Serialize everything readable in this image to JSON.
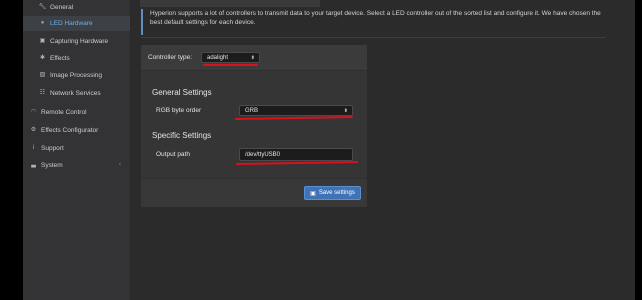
{
  "sidebar": {
    "items": [
      {
        "label": "General",
        "icon": "wrench-icon",
        "level": "sub",
        "active": false
      },
      {
        "label": "LED Hardware",
        "icon": "lightbulb-icon",
        "level": "sub",
        "active": true
      },
      {
        "label": "Capturing Hardware",
        "icon": "camera-icon",
        "level": "sub",
        "active": false
      },
      {
        "label": "Effects",
        "icon": "magic-icon",
        "level": "sub",
        "active": false
      },
      {
        "label": "Image Processing",
        "icon": "image-icon",
        "level": "sub",
        "active": false
      },
      {
        "label": "Network Services",
        "icon": "sitemap-icon",
        "level": "sub",
        "active": false
      },
      {
        "label": "Remote Control",
        "icon": "wifi-icon",
        "level": "top",
        "active": false
      },
      {
        "label": "Effects Configurator",
        "icon": "cogs-icon",
        "level": "top",
        "active": false
      },
      {
        "label": "Support",
        "icon": "info-icon",
        "level": "top",
        "active": false
      },
      {
        "label": "System",
        "icon": "chart-icon",
        "level": "top",
        "active": false
      }
    ]
  },
  "info": {
    "text": "Hyperion supports a lot of controllers to transmit data to your target device. Select a LED controller out of the sorted list and configure it. We have chosen the best default settings for each device."
  },
  "panel": {
    "controller_label": "Controller type:",
    "controller_value": "adalight",
    "general_title": "General Settings",
    "rgb_label": "RGB byte order",
    "rgb_value": "GRB",
    "specific_title": "Specific Settings",
    "output_label": "Output path",
    "output_value": "/dev/ttyUSB0",
    "save_label": "Save settings"
  },
  "colors": {
    "accent": "#3f73b5",
    "annotation": "#d8111c",
    "active_nav": "#6fb0ee"
  }
}
